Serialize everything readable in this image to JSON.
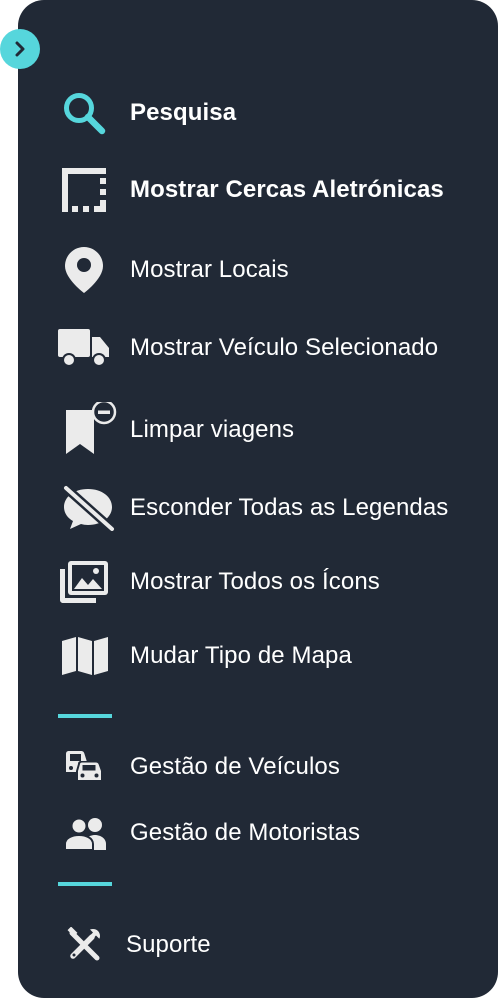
{
  "colors": {
    "panel_bg": "#212936",
    "accent": "#56d6dc",
    "icon": "#ebebeb",
    "text": "#ffffff"
  },
  "toggle": {
    "icon": "chevron-right-icon"
  },
  "menu": {
    "items": [
      {
        "label": "Pesquisa",
        "icon": "search-icon"
      },
      {
        "label": "Mostrar Cercas Aletrónicas",
        "icon": "geofence-icon"
      },
      {
        "label": "Mostrar Locais",
        "icon": "location-pin-icon"
      },
      {
        "label": "Mostrar Veículo Selecionado",
        "icon": "truck-icon"
      },
      {
        "label": "Limpar viagens",
        "icon": "bookmark-remove-icon"
      },
      {
        "label": "Esconder Todas as Legendas",
        "icon": "speech-bubble-off-icon"
      },
      {
        "label": "Mostrar Todos os Ícons",
        "icon": "photo-library-icon"
      },
      {
        "label": "Mudar Tipo de Mapa",
        "icon": "map-icon"
      }
    ],
    "management": [
      {
        "label": "Gestão de Veículos",
        "icon": "cars-icon"
      },
      {
        "label": "Gestão de Motoristas",
        "icon": "people-icon"
      }
    ],
    "support": {
      "label": "Suporte",
      "icon": "tools-icon"
    }
  }
}
